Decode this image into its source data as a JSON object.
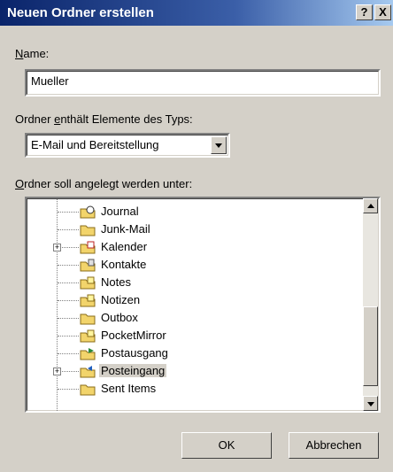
{
  "dialog": {
    "title": "Neuen Ordner erstellen",
    "help_label": "?",
    "close_label": "X"
  },
  "name_field": {
    "label_key": "N",
    "label_rest": "ame:",
    "value": "Mueller"
  },
  "type_field": {
    "label_pre": "Ordner ",
    "label_key": "e",
    "label_post": "nthält Elemente des Typs:",
    "selected": "E-Mail und Bereitstellung"
  },
  "location": {
    "label_key": "O",
    "label_rest": "rdner soll angelegt werden unter:",
    "items": [
      {
        "label": "Journal",
        "expander": false,
        "icon": "journal-icon",
        "selected": false
      },
      {
        "label": "Junk-Mail",
        "expander": false,
        "icon": "folder-icon",
        "selected": false
      },
      {
        "label": "Kalender",
        "expander": true,
        "icon": "calendar-icon",
        "selected": false
      },
      {
        "label": "Kontakte",
        "expander": false,
        "icon": "contacts-icon",
        "selected": false
      },
      {
        "label": "Notes",
        "expander": false,
        "icon": "note-folder-icon",
        "selected": false
      },
      {
        "label": "Notizen",
        "expander": false,
        "icon": "note-folder-icon",
        "selected": false
      },
      {
        "label": "Outbox",
        "expander": false,
        "icon": "folder-icon",
        "selected": false
      },
      {
        "label": "PocketMirror",
        "expander": false,
        "icon": "note-folder-icon",
        "selected": false
      },
      {
        "label": "Postausgang",
        "expander": false,
        "icon": "outbox-icon",
        "selected": false
      },
      {
        "label": "Posteingang",
        "expander": true,
        "icon": "inbox-icon",
        "selected": true
      },
      {
        "label": "Sent Items",
        "expander": false,
        "icon": "folder-icon",
        "selected": false
      }
    ]
  },
  "buttons": {
    "ok": "OK",
    "cancel": "Abbrechen"
  },
  "colors": {
    "dialog_bg": "#d4d0c8",
    "title_bar": "#0a246a",
    "folder": "#f2d46b"
  }
}
